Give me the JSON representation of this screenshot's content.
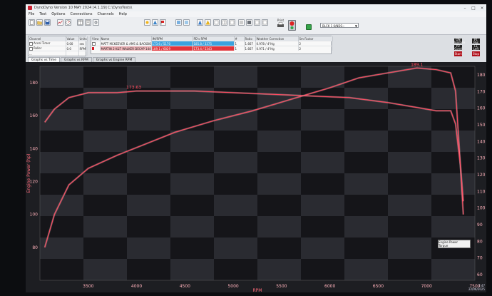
{
  "window": {
    "title": "DynoDyno Version 10 MAY 2024 [4.1.19] C:\\DynoTests\\"
  },
  "menu": [
    "File",
    "Test",
    "Options",
    "Connections",
    "Channels",
    "Help"
  ],
  "toolbar": {
    "print_label": "Print",
    "device_select": "BLCK 1 6/NDS~"
  },
  "channel_table": {
    "headers": [
      "Channel",
      "Value",
      "Units"
    ],
    "rows": [
      {
        "channel": "Accel Timer",
        "value": "0.00",
        "units": "sec"
      },
      {
        "channel": "Roller",
        "value": "0.0",
        "units": "RPM"
      },
      {
        "channel": "...",
        "value": "",
        "units": ""
      }
    ]
  },
  "runs_table": {
    "headers": [
      "View",
      "Name",
      "IM/RPM",
      "PD's RPM",
      "#",
      "Ratio",
      "Weather Correction",
      "Sm Factor"
    ],
    "rows": [
      {
        "name": "MATT MCKEEVER & AMS & BACKBO",
        "rpm": "173.6 / 5170",
        "pd": "185.8 / 3375",
        "num": "1",
        "ratio": "1.667",
        "weather": "0.978 / 4\"Hg",
        "sm": "2"
      },
      {
        "name": "MARTIN 2 K&T WALKER DECAP 144",
        "rpm": "189.1 / 6829",
        "pd": "173.4 / 5343",
        "num": "1",
        "ratio": "1.667",
        "weather": "0.971 / 4\"Hg",
        "sm": "2"
      }
    ]
  },
  "right_boxes": [
    {
      "label": "ON",
      "sub": "Ignition"
    },
    {
      "label": "P1",
      "sub": "Pos"
    },
    {
      "label": "P2",
      "sub": "Cond"
    },
    {
      "label": "L1",
      "sub": "Left"
    },
    {
      "label": "Start",
      "sub": ""
    },
    {
      "label": "Stop",
      "sub": ""
    }
  ],
  "tabs": [
    "Graphs vs Time",
    "Graphs vs RPM",
    "Graphs vs Engine RPM"
  ],
  "legend": {
    "left_title": "Engine Power",
    "items": [
      "Engine Power",
      "Torque"
    ],
    "values": [
      "173.63",
      "189.1"
    ]
  },
  "taskbar": {
    "time": "7:47",
    "date": "22/06/2025"
  },
  "colors": {
    "trace": "#ff4a60",
    "trace_glow": "#ffc2c8",
    "grid_band_light": "#2a2b31",
    "grid_band_dark": "#151519"
  },
  "chart_data": {
    "type": "line",
    "ylabel": "Engine Power (hp)",
    "xlabel": "RPM",
    "x_ticks": [
      "3500",
      "4000",
      "4500",
      "5000",
      "5500",
      "6000",
      "6500",
      "7000",
      "7500"
    ],
    "y_ticks": [
      "80",
      "100",
      "120",
      "140",
      "160",
      "180"
    ],
    "right_y_ticks": [
      "180",
      "170",
      "160",
      "150",
      "140",
      "130",
      "120",
      "110",
      "100",
      "90",
      "80",
      "70",
      "60"
    ],
    "xlim": [
      3000,
      7500
    ],
    "ylim": [
      60,
      190
    ],
    "peak_labels": [
      "173.63",
      "189.1"
    ],
    "series": [
      {
        "x": [
          3050,
          3150,
          3300,
          3500,
          3800,
          4100,
          4400,
          4800,
          5200,
          5600,
          6000,
          6300,
          6600,
          6900,
          7100,
          7250,
          7300,
          7350,
          7380
        ],
        "y": [
          80,
          100,
          118,
          128,
          136,
          143,
          150,
          157,
          163,
          170,
          177,
          183,
          186,
          189,
          188,
          186,
          175,
          130,
          100
        ]
      },
      {
        "x": [
          3050,
          3150,
          3300,
          3500,
          3800,
          4000,
          4200,
          4600,
          5000,
          5400,
          5800,
          6200,
          6600,
          6900,
          7100,
          7250,
          7300,
          7350,
          7380
        ],
        "y": [
          156,
          164,
          171,
          174,
          174,
          175,
          175,
          175,
          174,
          173,
          172,
          171,
          168,
          165,
          163,
          163,
          155,
          130,
          108
        ]
      }
    ]
  }
}
